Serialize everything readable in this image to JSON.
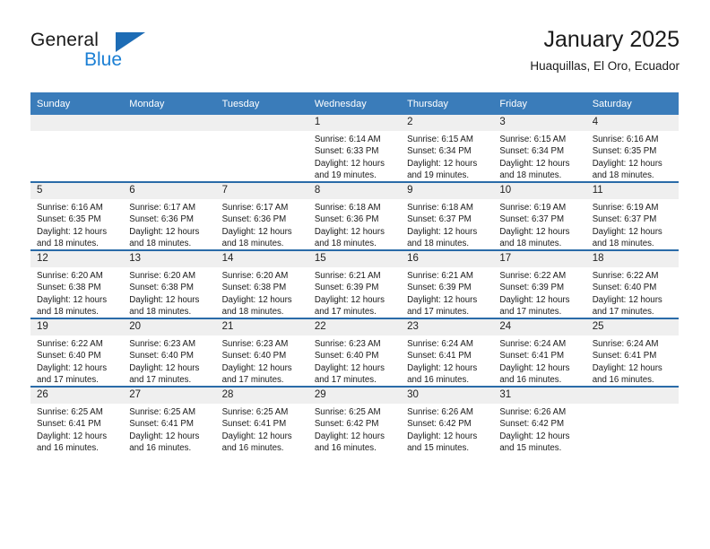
{
  "brand": {
    "name_top": "General",
    "name_bottom": "Blue",
    "accent_color": "#1b7fd4",
    "triangle_color": "#1d6cb5"
  },
  "header": {
    "title": "January 2025",
    "subtitle": "Huaquillas, El Oro, Ecuador"
  },
  "theme": {
    "header_row_bg": "#3a7cba",
    "row_separator": "#2a6ba8",
    "daynum_band_bg": "#efefef"
  },
  "weekdays": [
    "Sunday",
    "Monday",
    "Tuesday",
    "Wednesday",
    "Thursday",
    "Friday",
    "Saturday"
  ],
  "weeks": [
    [
      {
        "day": "",
        "empty": true,
        "sunrise": "",
        "sunset": "",
        "daylight_line1": "",
        "daylight_line2": ""
      },
      {
        "day": "",
        "empty": true,
        "sunrise": "",
        "sunset": "",
        "daylight_line1": "",
        "daylight_line2": ""
      },
      {
        "day": "",
        "empty": true,
        "sunrise": "",
        "sunset": "",
        "daylight_line1": "",
        "daylight_line2": ""
      },
      {
        "day": "1",
        "sunrise": "Sunrise: 6:14 AM",
        "sunset": "Sunset: 6:33 PM",
        "daylight_line1": "Daylight: 12 hours",
        "daylight_line2": "and 19 minutes."
      },
      {
        "day": "2",
        "sunrise": "Sunrise: 6:15 AM",
        "sunset": "Sunset: 6:34 PM",
        "daylight_line1": "Daylight: 12 hours",
        "daylight_line2": "and 19 minutes."
      },
      {
        "day": "3",
        "sunrise": "Sunrise: 6:15 AM",
        "sunset": "Sunset: 6:34 PM",
        "daylight_line1": "Daylight: 12 hours",
        "daylight_line2": "and 18 minutes."
      },
      {
        "day": "4",
        "sunrise": "Sunrise: 6:16 AM",
        "sunset": "Sunset: 6:35 PM",
        "daylight_line1": "Daylight: 12 hours",
        "daylight_line2": "and 18 minutes."
      }
    ],
    [
      {
        "day": "5",
        "sunrise": "Sunrise: 6:16 AM",
        "sunset": "Sunset: 6:35 PM",
        "daylight_line1": "Daylight: 12 hours",
        "daylight_line2": "and 18 minutes."
      },
      {
        "day": "6",
        "sunrise": "Sunrise: 6:17 AM",
        "sunset": "Sunset: 6:36 PM",
        "daylight_line1": "Daylight: 12 hours",
        "daylight_line2": "and 18 minutes."
      },
      {
        "day": "7",
        "sunrise": "Sunrise: 6:17 AM",
        "sunset": "Sunset: 6:36 PM",
        "daylight_line1": "Daylight: 12 hours",
        "daylight_line2": "and 18 minutes."
      },
      {
        "day": "8",
        "sunrise": "Sunrise: 6:18 AM",
        "sunset": "Sunset: 6:36 PM",
        "daylight_line1": "Daylight: 12 hours",
        "daylight_line2": "and 18 minutes."
      },
      {
        "day": "9",
        "sunrise": "Sunrise: 6:18 AM",
        "sunset": "Sunset: 6:37 PM",
        "daylight_line1": "Daylight: 12 hours",
        "daylight_line2": "and 18 minutes."
      },
      {
        "day": "10",
        "sunrise": "Sunrise: 6:19 AM",
        "sunset": "Sunset: 6:37 PM",
        "daylight_line1": "Daylight: 12 hours",
        "daylight_line2": "and 18 minutes."
      },
      {
        "day": "11",
        "sunrise": "Sunrise: 6:19 AM",
        "sunset": "Sunset: 6:37 PM",
        "daylight_line1": "Daylight: 12 hours",
        "daylight_line2": "and 18 minutes."
      }
    ],
    [
      {
        "day": "12",
        "sunrise": "Sunrise: 6:20 AM",
        "sunset": "Sunset: 6:38 PM",
        "daylight_line1": "Daylight: 12 hours",
        "daylight_line2": "and 18 minutes."
      },
      {
        "day": "13",
        "sunrise": "Sunrise: 6:20 AM",
        "sunset": "Sunset: 6:38 PM",
        "daylight_line1": "Daylight: 12 hours",
        "daylight_line2": "and 18 minutes."
      },
      {
        "day": "14",
        "sunrise": "Sunrise: 6:20 AM",
        "sunset": "Sunset: 6:38 PM",
        "daylight_line1": "Daylight: 12 hours",
        "daylight_line2": "and 18 minutes."
      },
      {
        "day": "15",
        "sunrise": "Sunrise: 6:21 AM",
        "sunset": "Sunset: 6:39 PM",
        "daylight_line1": "Daylight: 12 hours",
        "daylight_line2": "and 17 minutes."
      },
      {
        "day": "16",
        "sunrise": "Sunrise: 6:21 AM",
        "sunset": "Sunset: 6:39 PM",
        "daylight_line1": "Daylight: 12 hours",
        "daylight_line2": "and 17 minutes."
      },
      {
        "day": "17",
        "sunrise": "Sunrise: 6:22 AM",
        "sunset": "Sunset: 6:39 PM",
        "daylight_line1": "Daylight: 12 hours",
        "daylight_line2": "and 17 minutes."
      },
      {
        "day": "18",
        "sunrise": "Sunrise: 6:22 AM",
        "sunset": "Sunset: 6:40 PM",
        "daylight_line1": "Daylight: 12 hours",
        "daylight_line2": "and 17 minutes."
      }
    ],
    [
      {
        "day": "19",
        "sunrise": "Sunrise: 6:22 AM",
        "sunset": "Sunset: 6:40 PM",
        "daylight_line1": "Daylight: 12 hours",
        "daylight_line2": "and 17 minutes."
      },
      {
        "day": "20",
        "sunrise": "Sunrise: 6:23 AM",
        "sunset": "Sunset: 6:40 PM",
        "daylight_line1": "Daylight: 12 hours",
        "daylight_line2": "and 17 minutes."
      },
      {
        "day": "21",
        "sunrise": "Sunrise: 6:23 AM",
        "sunset": "Sunset: 6:40 PM",
        "daylight_line1": "Daylight: 12 hours",
        "daylight_line2": "and 17 minutes."
      },
      {
        "day": "22",
        "sunrise": "Sunrise: 6:23 AM",
        "sunset": "Sunset: 6:40 PM",
        "daylight_line1": "Daylight: 12 hours",
        "daylight_line2": "and 17 minutes."
      },
      {
        "day": "23",
        "sunrise": "Sunrise: 6:24 AM",
        "sunset": "Sunset: 6:41 PM",
        "daylight_line1": "Daylight: 12 hours",
        "daylight_line2": "and 16 minutes."
      },
      {
        "day": "24",
        "sunrise": "Sunrise: 6:24 AM",
        "sunset": "Sunset: 6:41 PM",
        "daylight_line1": "Daylight: 12 hours",
        "daylight_line2": "and 16 minutes."
      },
      {
        "day": "25",
        "sunrise": "Sunrise: 6:24 AM",
        "sunset": "Sunset: 6:41 PM",
        "daylight_line1": "Daylight: 12 hours",
        "daylight_line2": "and 16 minutes."
      }
    ],
    [
      {
        "day": "26",
        "sunrise": "Sunrise: 6:25 AM",
        "sunset": "Sunset: 6:41 PM",
        "daylight_line1": "Daylight: 12 hours",
        "daylight_line2": "and 16 minutes."
      },
      {
        "day": "27",
        "sunrise": "Sunrise: 6:25 AM",
        "sunset": "Sunset: 6:41 PM",
        "daylight_line1": "Daylight: 12 hours",
        "daylight_line2": "and 16 minutes."
      },
      {
        "day": "28",
        "sunrise": "Sunrise: 6:25 AM",
        "sunset": "Sunset: 6:41 PM",
        "daylight_line1": "Daylight: 12 hours",
        "daylight_line2": "and 16 minutes."
      },
      {
        "day": "29",
        "sunrise": "Sunrise: 6:25 AM",
        "sunset": "Sunset: 6:42 PM",
        "daylight_line1": "Daylight: 12 hours",
        "daylight_line2": "and 16 minutes."
      },
      {
        "day": "30",
        "sunrise": "Sunrise: 6:26 AM",
        "sunset": "Sunset: 6:42 PM",
        "daylight_line1": "Daylight: 12 hours",
        "daylight_line2": "and 15 minutes."
      },
      {
        "day": "31",
        "sunrise": "Sunrise: 6:26 AM",
        "sunset": "Sunset: 6:42 PM",
        "daylight_line1": "Daylight: 12 hours",
        "daylight_line2": "and 15 minutes."
      },
      {
        "day": "",
        "empty": true,
        "sunrise": "",
        "sunset": "",
        "daylight_line1": "",
        "daylight_line2": ""
      }
    ]
  ]
}
